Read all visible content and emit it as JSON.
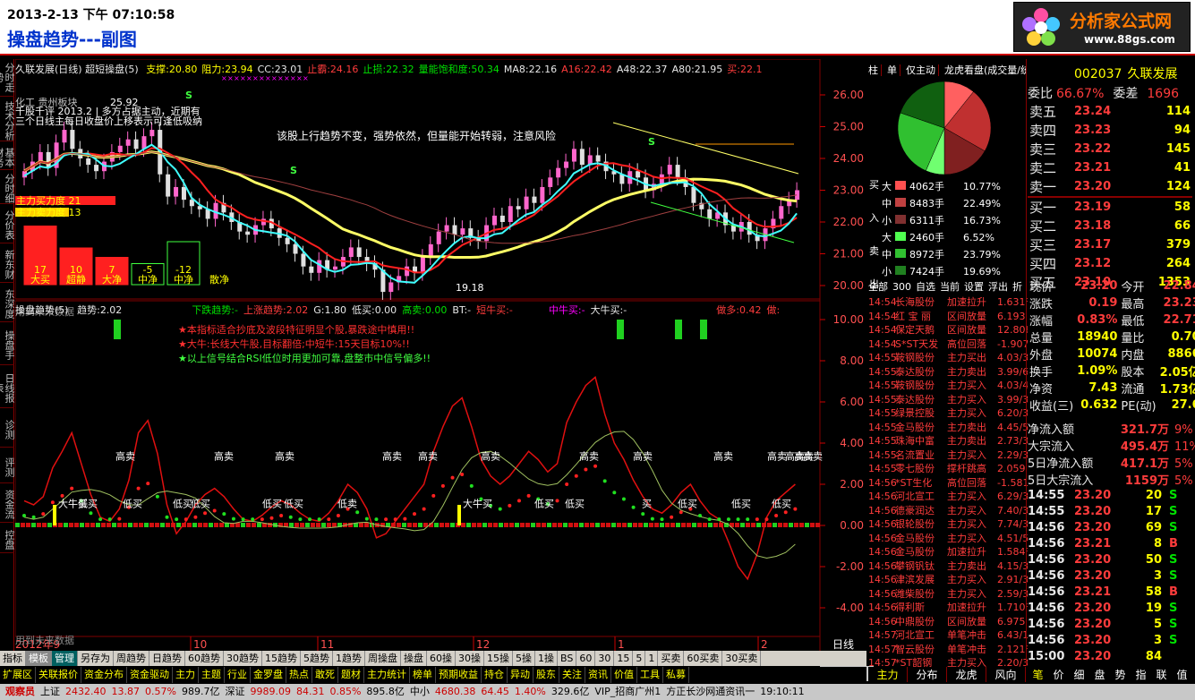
{
  "banner": {
    "datetime": "2013-2-13 下午 07:10:58",
    "title": "操盘趋势---副图",
    "logo_text": "分析家公式网",
    "logo_url": "www.88gs.com"
  },
  "lefttabs": [
    "分时走势",
    "技术分析",
    "基本财务",
    "分时细",
    "分价表",
    "新东财",
    "东深度",
    "操盘手",
    "日线报表",
    "诊测",
    "评测",
    "资金流",
    "控盘"
  ],
  "main_header": {
    "name": "久联发展(日线)",
    "formula": "超短操盘(5)",
    "items": [
      {
        "k": "支撑:",
        "v": "20.80"
      },
      {
        "k": "阻力:",
        "v": "23.94"
      },
      {
        "k": "CC:",
        "v": "23.01"
      },
      {
        "k": "止霸:",
        "v": "24.16"
      },
      {
        "k": "止损:",
        "v": "22.32"
      },
      {
        "k": "量能饱和度:",
        "v": "50.34"
      },
      {
        "k": "MA8:",
        "v": "22.16"
      },
      {
        "k": "A16:",
        "v": "22.42"
      },
      {
        "k": "A48:",
        "v": "22.37"
      },
      {
        "k": "A80:",
        "v": "21.95"
      },
      {
        "k": "买:",
        "v": "22.1"
      }
    ]
  },
  "main_overlay": {
    "sector": "化工 贵州板块",
    "stock_comment": "千股千评 2013.2 | 多方占据主动，近期有",
    "note2": "三个日线主每日收盘价上移表示可逢低吸纳",
    "trend_note": "该股上行趋势不变，强势依然，但量能开始转弱，注意风险",
    "buy_force": "主力买力度 21",
    "sell_force": "主力卖力度 13",
    "high_label": "25.92",
    "low_label": "19.18",
    "future_label": "用到未来数据",
    "bars": [
      {
        "v": "17",
        "label": "大买"
      },
      {
        "v": "10",
        "label": "超静"
      },
      {
        "v": "7",
        "label": "大净"
      },
      {
        "v": "-5",
        "label": "中净"
      },
      {
        "v": "-12",
        "label": "中净"
      },
      {
        "v": "",
        "label": "散净"
      }
    ]
  },
  "main_axis": [
    "26.00",
    "25.00",
    "24.00",
    "23.00",
    "22.00",
    "21.00",
    "20.00"
  ],
  "sub_header": {
    "name": "操盘趋势(5)",
    "items": [
      {
        "k": "趋势:",
        "v": "2.02"
      },
      {
        "k": "下跌趋势:",
        "v": "-"
      },
      {
        "k": "上涨趋势:",
        "v": "2.02"
      },
      {
        "k": "G:",
        "v": "1.80"
      },
      {
        "k": "低买:",
        "v": "0.00"
      },
      {
        "k": "高卖:",
        "v": "0.00"
      },
      {
        "k": "BT:",
        "v": "-"
      },
      {
        "k": "短牛买:",
        "v": "-"
      },
      {
        "k": "中牛买:",
        "v": "-"
      },
      {
        "k": "大牛买:",
        "v": "-"
      },
      {
        "k": "做多:",
        "v": "0.42"
      },
      {
        "k": "做:",
        "v": ""
      }
    ]
  },
  "sub_notes": [
    "★本指标适合抄底及波段特征明显个股,暴跌途中慎用!!",
    "★大牛:长线大牛股,目标翻倍;中短牛:15天目标10%!!",
    "★以上信号结合RSI低位时用更加可靠,盘整市中信号偏多!!"
  ],
  "sub_axis": [
    "10.00",
    "8.00",
    "6.00",
    "4.00",
    "2.00",
    "0.00",
    "-2.00",
    "-4.00"
  ],
  "sub_future_label": "用到未来数据",
  "signals": [
    "大牛买",
    "低买",
    "低买",
    "低买",
    "高卖",
    "低买",
    "高卖",
    "低买",
    "高卖",
    "高卖",
    "低卖",
    "大牛买",
    "高卖",
    "高卖",
    "低买",
    "低买",
    "高卖",
    "高卖",
    "低买",
    "高卖",
    "低买",
    "高卖",
    "高卖",
    "低买",
    "高卖",
    "高卖",
    "低买",
    "买"
  ],
  "date_axis": {
    "start": "2012年9",
    "labels": [
      "10",
      "11",
      "12",
      "1",
      "2"
    ],
    "period": "日线"
  },
  "tabs": [
    "指标",
    "模板",
    "管理",
    "另存为",
    "周趋势",
    "日趋势",
    "60趋势",
    "30趋势",
    "15趋势",
    "5趋势",
    "1趋势",
    "周操盘",
    "操盘",
    "60操",
    "30操",
    "15操",
    "5操",
    "1操",
    "BS",
    "60",
    "30",
    "15",
    "5",
    "1",
    "买卖",
    "60买卖",
    "30买卖"
  ],
  "menus": [
    "扩展区",
    "关联报价",
    "资金分布",
    "资金驱动",
    "主力",
    "主题",
    "行业",
    "金罗盘",
    "热点",
    "敢死",
    "题材",
    "主力统计",
    "榜单",
    "预期收益",
    "持仓",
    "异动",
    "股东",
    "关注",
    "资讯",
    "价值",
    "工具",
    "私募"
  ],
  "status": {
    "segments": [
      "观察员",
      "上证",
      "2432.40",
      "13.87",
      "0.57%",
      "989.7亿",
      "深证",
      "9989.09",
      "84.31",
      "0.85%",
      "895.8亿",
      "中小",
      "4680.38",
      "64.45",
      "1.40%",
      "329.6亿",
      "VIP_招商广州1",
      "方正长沙网通资讯一",
      "19:10:11"
    ]
  },
  "right": {
    "tabs": [
      "柱",
      "单",
      "仅主动",
      "龙虎看盘(成交量/统"
    ],
    "code": "002037",
    "name": "久联发展",
    "weibi": {
      "k1": "委比",
      "v1": "66.67%",
      "k2": "委差",
      "v2": "1696"
    },
    "asks": [
      {
        "k": "卖五",
        "p": "23.24",
        "v": "114"
      },
      {
        "k": "卖四",
        "p": "23.23",
        "v": "94"
      },
      {
        "k": "卖三",
        "p": "23.22",
        "v": "145"
      },
      {
        "k": "卖二",
        "p": "23.21",
        "v": "41"
      },
      {
        "k": "卖一",
        "p": "23.20",
        "v": "124"
      }
    ],
    "bids": [
      {
        "k": "买一",
        "p": "23.19",
        "v": "58"
      },
      {
        "k": "买二",
        "p": "23.18",
        "v": "66"
      },
      {
        "k": "买三",
        "p": "23.17",
        "v": "379"
      },
      {
        "k": "买四",
        "p": "23.12",
        "v": "264"
      },
      {
        "k": "买五",
        "p": "23.10",
        "v": "1353"
      }
    ],
    "flow": [
      {
        "side": "买入",
        "size": "大",
        "vol": "4062手",
        "pct": "10.77%",
        "color": "#ff5050"
      },
      {
        "side": "",
        "size": "中",
        "vol": "8483手",
        "pct": "22.49%",
        "color": "#c04040"
      },
      {
        "side": "",
        "size": "小",
        "vol": "6311手",
        "pct": "16.73%",
        "color": "#803030"
      },
      {
        "side": "卖出",
        "size": "大",
        "vol": "2460手",
        "pct": "6.52%",
        "color": "#50ff50"
      },
      {
        "side": "",
        "size": "中",
        "vol": "8972手",
        "pct": "23.79%",
        "color": "#30c030"
      },
      {
        "side": "",
        "size": "小",
        "vol": "7424手",
        "pct": "19.69%",
        "color": "#208020"
      }
    ],
    "pie": [
      10.77,
      22.49,
      16.73,
      6.52,
      23.79,
      19.69
    ],
    "pie_colors": [
      "#ff6060",
      "#c03030",
      "#802020",
      "#70ff70",
      "#30c030",
      "#106010"
    ],
    "stats": [
      {
        "k1": "现价",
        "v1": "23.20",
        "k2": "今开",
        "v2": "22.84"
      },
      {
        "k1": "涨跌",
        "v1": "0.19",
        "k2": "最高",
        "v2": "23.23"
      },
      {
        "k1": "涨幅",
        "v1": "0.83%",
        "k2": "最低",
        "v2": "22.71"
      },
      {
        "k1": "总量",
        "v1": "18940",
        "k2": "量比",
        "v2": "0.70"
      },
      {
        "k1": "外盘",
        "v1": "10074",
        "k2": "内盘",
        "v2": "8866"
      },
      {
        "k1": "换手",
        "v1": "1.09%",
        "k2": "股本",
        "v2": "2.05亿"
      },
      {
        "k1": "净资",
        "v1": "7.43",
        "k2": "流通",
        "v2": "1.73亿"
      },
      {
        "k1": "收益(三)",
        "v1": "0.632",
        "k2": "PE(动)",
        "v2": "27.6"
      }
    ],
    "netflow": [
      {
        "k": "净流入额",
        "v": "321.7万",
        "p": "9%"
      },
      {
        "k": "大宗流入",
        "v": "495.4万",
        "p": "11%"
      },
      {
        "k": "5日净流入额",
        "v": "417.1万",
        "p": "5%"
      },
      {
        "k": "5日大宗流入",
        "v": "1159万",
        "p": "5%"
      }
    ],
    "list_tabs": [
      "全部",
      "300",
      "自选",
      "当前",
      "设置",
      "浮出",
      "折"
    ],
    "list": [
      {
        "t": "14:54",
        "n": "长海股份",
        "a": "加速拉升",
        "v": "1.631%"
      },
      {
        "t": "14:54",
        "n": "红 宝 丽",
        "a": "区间放量",
        "v": "6.193"
      },
      {
        "t": "14:54",
        "n": "保定天鹅",
        "a": "区间放量",
        "v": "12.808"
      },
      {
        "t": "14:54",
        "n": "S*ST天发",
        "a": "高位回落",
        "v": "-1.907"
      },
      {
        "t": "14:55",
        "n": "鞍钢股份",
        "a": "主力买出",
        "v": "4.03/3"
      },
      {
        "t": "14:55",
        "n": "泰达股份",
        "a": "主力卖出",
        "v": "3.99/6"
      },
      {
        "t": "14:55",
        "n": "鞍钢股份",
        "a": "主力买入",
        "v": "4.03/4"
      },
      {
        "t": "14:55",
        "n": "泰达股份",
        "a": "主力买入",
        "v": "3.99/3"
      },
      {
        "t": "14:55",
        "n": "绿景控股",
        "a": "主力买入",
        "v": "6.20/3"
      },
      {
        "t": "14:55",
        "n": "金马股份",
        "a": "主力卖出",
        "v": "4.45/5"
      },
      {
        "t": "14:55",
        "n": "珠海中富",
        "a": "主力卖出",
        "v": "2.73/3"
      },
      {
        "t": "14:55",
        "n": "名流置业",
        "a": "主力买入",
        "v": "2.29/3"
      },
      {
        "t": "14:55",
        "n": "零七股份",
        "a": "撑杆跳高",
        "v": "2.059"
      },
      {
        "t": "14:56",
        "n": "*ST生化",
        "a": "高位回落",
        "v": "-1.581"
      },
      {
        "t": "14:56",
        "n": "河北宣工",
        "a": "主力买入",
        "v": "6.29/3"
      },
      {
        "t": "14:56",
        "n": "德豪润达",
        "a": "主力买入",
        "v": "7.40/3"
      },
      {
        "t": "14:56",
        "n": "银轮股份",
        "a": "主力买入",
        "v": "7.74/3"
      },
      {
        "t": "14:56",
        "n": "金马股份",
        "a": "主力买入",
        "v": "4.51/5"
      },
      {
        "t": "14:56",
        "n": "金马股份",
        "a": "加速拉升",
        "v": "1.584%"
      },
      {
        "t": "14:56",
        "n": "攀钢钒钛",
        "a": "主力卖出",
        "v": "4.15/3"
      },
      {
        "t": "14:56",
        "n": "津滨发展",
        "a": "主力买入",
        "v": "2.91/3"
      },
      {
        "t": "14:56",
        "n": "潍柴股份",
        "a": "主力买入",
        "v": "2.59/3"
      },
      {
        "t": "14:56",
        "n": "得利斯",
        "a": "加速拉升",
        "v": "1.710%"
      },
      {
        "t": "14:56",
        "n": "中鼎股份",
        "a": "区间放量",
        "v": "6.975"
      },
      {
        "t": "14:57",
        "n": "河北宣工",
        "a": "单笔冲击",
        "v": "6.43/1"
      },
      {
        "t": "14:57",
        "n": "智云股份",
        "a": "单笔冲击",
        "v": "2.121%"
      },
      {
        "t": "14:57",
        "n": "*ST韶钢",
        "a": "主力买入",
        "v": "2.20/3"
      }
    ],
    "ticks": [
      {
        "t": "14:55",
        "p": "23.20",
        "v": "20",
        "s": "S"
      },
      {
        "t": "14:55",
        "p": "23.20",
        "v": "17",
        "s": "S"
      },
      {
        "t": "14:56",
        "p": "23.20",
        "v": "69",
        "s": "S"
      },
      {
        "t": "14:56",
        "p": "23.21",
        "v": "8",
        "s": "B"
      },
      {
        "t": "14:56",
        "p": "23.20",
        "v": "50",
        "s": "S"
      },
      {
        "t": "14:56",
        "p": "23.20",
        "v": "3",
        "s": "S"
      },
      {
        "t": "14:56",
        "p": "23.21",
        "v": "58",
        "s": "B"
      },
      {
        "t": "14:56",
        "p": "23.20",
        "v": "19",
        "s": "S"
      },
      {
        "t": "14:56",
        "p": "23.20",
        "v": "5",
        "s": "S"
      },
      {
        "t": "14:56",
        "p": "23.20",
        "v": "3",
        "s": "S"
      },
      {
        "t": "15:00",
        "p": "23.20",
        "v": "84",
        "s": ""
      }
    ],
    "bottom_left_tabs": [
      "资讯总览"
    ],
    "bottom_tabs": [
      "主力",
      "分布",
      "龙虎",
      "风向"
    ],
    "bottom_icons": [
      "笔",
      "价",
      "细",
      "盘",
      "势",
      "指",
      "联",
      "值"
    ]
  }
}
